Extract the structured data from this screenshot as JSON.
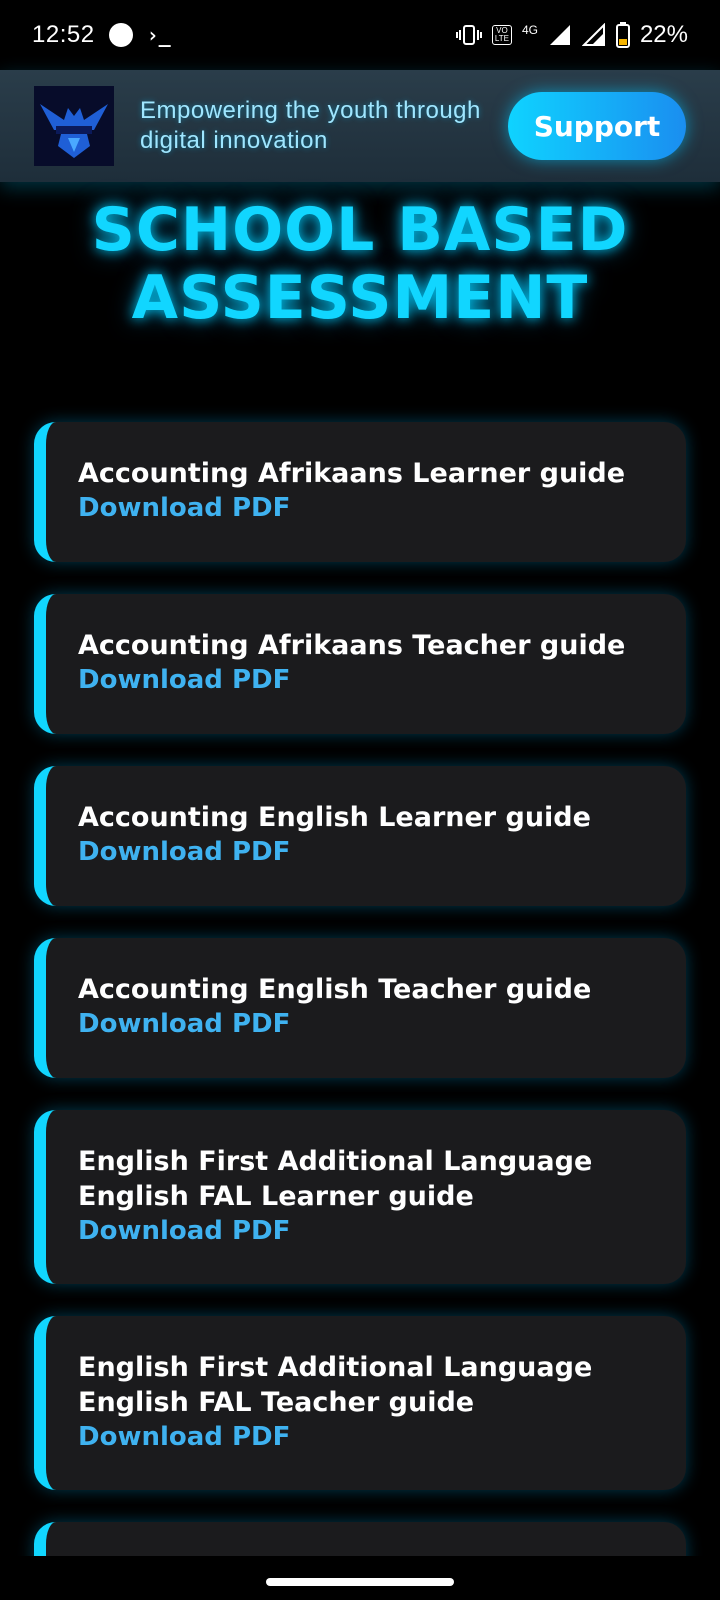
{
  "status_bar": {
    "time": "12:52",
    "terminal_glyph": "›_",
    "volte_top": "VO",
    "volte_bottom": "LTE",
    "network": "4G",
    "battery_percent": "22%"
  },
  "header": {
    "tagline": "Empowering the youth through digital innovation",
    "support_label": "Support"
  },
  "title": "SCHOOL BASED ASSESSMENT",
  "cards": [
    {
      "title": "Accounting Afrikaans Learner guide",
      "link": "Download PDF"
    },
    {
      "title": "Accounting Afrikaans Teacher guide",
      "link": "Download PDF"
    },
    {
      "title": "Accounting English Learner guide",
      "link": "Download PDF"
    },
    {
      "title": "Accounting English Teacher guide",
      "link": "Download PDF"
    },
    {
      "title": "English First Additional Language English FAL Learner guide",
      "link": "Download PDF"
    },
    {
      "title": "English First Additional Language English FAL Teacher guide",
      "link": "Download PDF"
    }
  ],
  "colors": {
    "accent": "#11d6ff",
    "link": "#3fb2f0",
    "card_bg": "#1b1b1d"
  }
}
